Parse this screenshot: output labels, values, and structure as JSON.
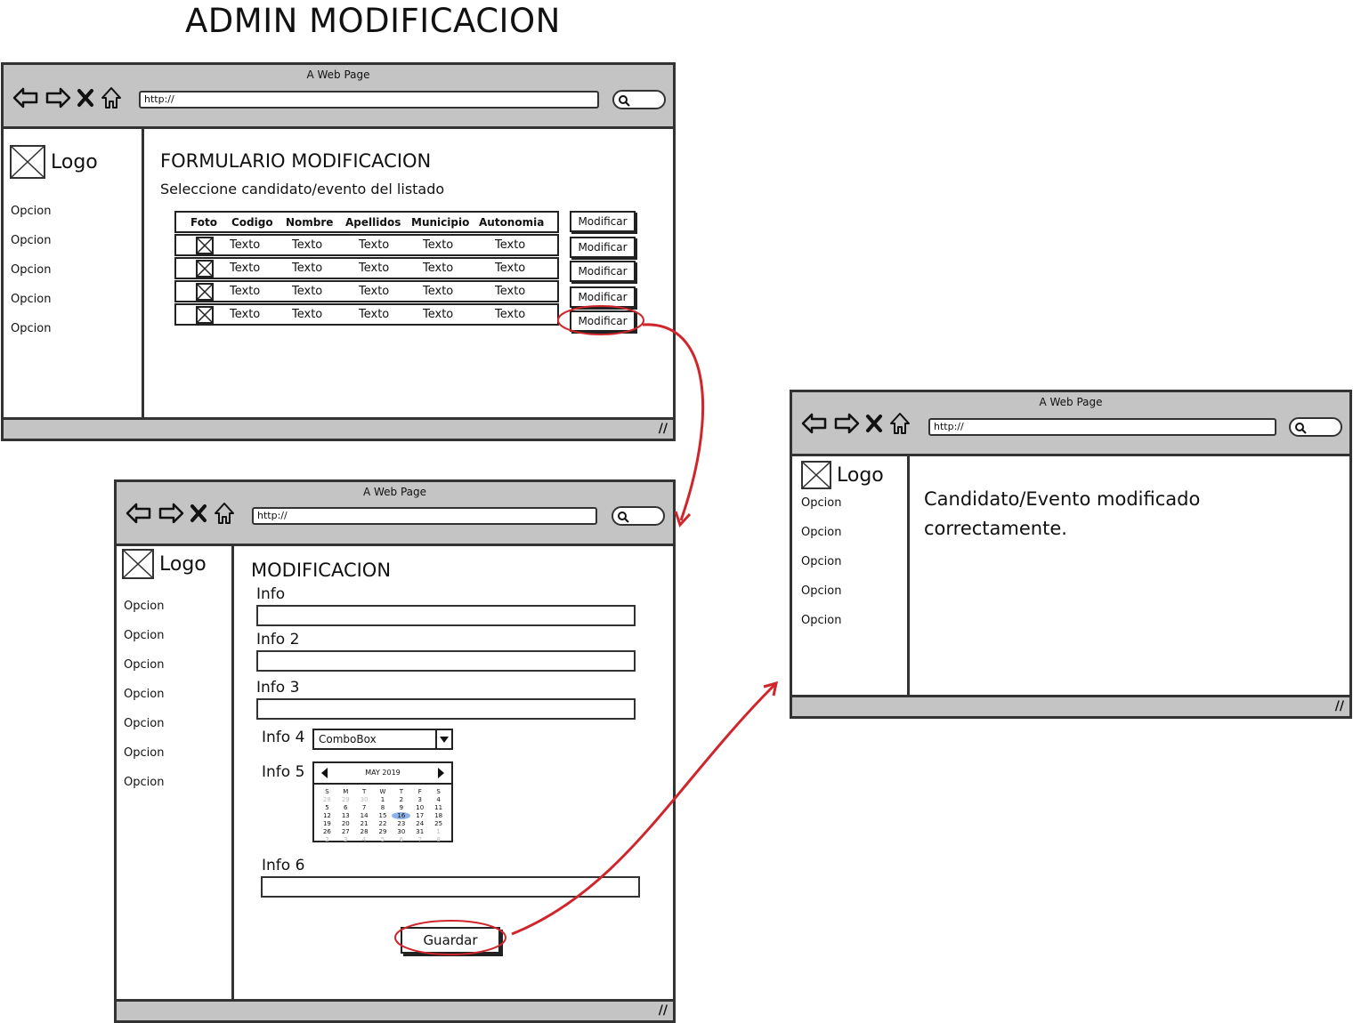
{
  "page_title": "ADMIN MODIFICACION",
  "browser": {
    "window_title": "A Web Page",
    "url": "http://"
  },
  "logo_text": "Logo",
  "window1": {
    "heading": "FORMULARIO MODIFICACION",
    "subheading": "Seleccione candidato/evento del listado",
    "sidebar": [
      "Opcion",
      "Opcion",
      "Opcion",
      "Opcion",
      "Opcion"
    ],
    "table": {
      "headers": [
        "Foto",
        "Codigo",
        "Nombre",
        "Apellidos",
        "Municipio",
        "Autonomia"
      ],
      "rows": [
        [
          "Texto",
          "Texto",
          "Texto",
          "Texto",
          "Texto"
        ],
        [
          "Texto",
          "Texto",
          "Texto",
          "Texto",
          "Texto"
        ],
        [
          "Texto",
          "Texto",
          "Texto",
          "Texto",
          "Texto"
        ],
        [
          "Texto",
          "Texto",
          "Texto",
          "Texto",
          "Texto"
        ]
      ]
    },
    "button_label": "Modificar"
  },
  "window2": {
    "heading": "MODIFICACION",
    "sidebar": [
      "Opcion",
      "Opcion",
      "Opcion",
      "Opcion",
      "Opcion",
      "Opcion",
      "Opcion"
    ],
    "labels": {
      "info1": "Info",
      "info2": "Info 2",
      "info3": "Info 3",
      "info4": "Info 4",
      "info5": "Info 5",
      "info6": "Info 6"
    },
    "combobox_value": "ComboBox",
    "calendar": {
      "month": "MAY 2019",
      "weekdays": [
        "S",
        "M",
        "T",
        "W",
        "T",
        "F",
        "S"
      ],
      "days": [
        "28",
        "29",
        "30",
        "1",
        "2",
        "3",
        "4",
        "5",
        "6",
        "7",
        "8",
        "9",
        "10",
        "11",
        "12",
        "13",
        "14",
        "15",
        "16",
        "17",
        "18",
        "19",
        "20",
        "21",
        "22",
        "23",
        "24",
        "25",
        "26",
        "27",
        "28",
        "29",
        "30",
        "31",
        "1",
        "2",
        "3",
        "4",
        "5",
        "6",
        "7",
        "8"
      ],
      "selected_day": "16"
    },
    "save_label": "Guardar"
  },
  "window3": {
    "message_line1": "Candidato/Evento modificado",
    "message_line2": "correctamente.",
    "sidebar": [
      "Opcion",
      "Opcion",
      "Opcion",
      "Opcion",
      "Opcion"
    ]
  },
  "colors": {
    "chrome": "#c4c4c4",
    "flow_arrow": "#d0262b",
    "selected_day": "#8fb3e8"
  }
}
